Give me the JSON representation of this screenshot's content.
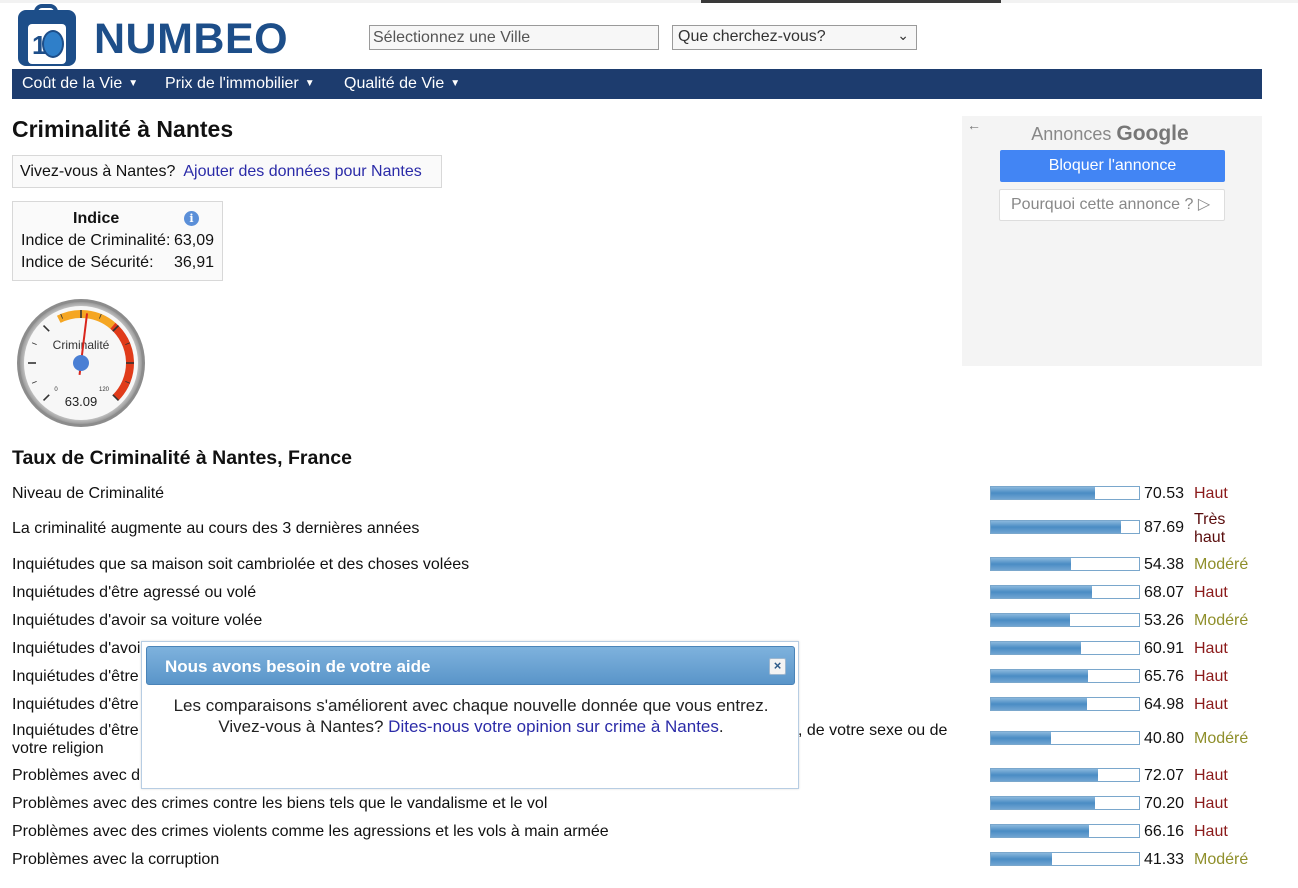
{
  "header": {
    "logo_text": "NUMBEO",
    "city_placeholder": "Sélectionnez une Ville",
    "search_select_value": "Que cherchez-vous?"
  },
  "nav": {
    "items": [
      {
        "label": "Coût de la Vie"
      },
      {
        "label": "Prix de l'immobilier"
      },
      {
        "label": "Qualité de Vie"
      }
    ]
  },
  "page": {
    "title": "Criminalité à Nantes",
    "live_question": "Vivez-vous à Nantes?",
    "live_link": "Ajouter des données pour Nantes"
  },
  "index": {
    "heading": "Indice",
    "crime_label": "Indice de Criminalité:",
    "crime_value": "63,09",
    "safety_label": "Indice de Sécurité:",
    "safety_value": "36,91"
  },
  "gauge": {
    "label": "Criminalité",
    "value": "63.09",
    "numeric_value": 63.09,
    "min_label": "0",
    "max_label": "120",
    "max": 120
  },
  "ad": {
    "back_icon": "arrow-left-icon",
    "title_prefix": "Annonces",
    "title_brand": "Google",
    "block_label": "Bloquer l'annonce",
    "why_label": "Pourquoi cette annonce ?"
  },
  "section": {
    "title": "Taux de Criminalité à Nantes, France"
  },
  "crime_rows": [
    {
      "label": "Niveau de Criminalité",
      "value": "70.53",
      "level": "Haut",
      "pct": 70.53
    },
    {
      "label": "La criminalité augmente au cours des 3 dernières années",
      "value": "87.69",
      "level": "Très haut",
      "pct": 87.69
    },
    {
      "label": "Inquiétudes que sa maison soit cambriolée et des choses volées",
      "value": "54.38",
      "level": "Modéré",
      "pct": 54.38
    },
    {
      "label": "Inquiétudes d'être agressé ou volé",
      "value": "68.07",
      "level": "Haut",
      "pct": 68.07
    },
    {
      "label": "Inquiétudes d'avoir sa voiture volée",
      "value": "53.26",
      "level": "Modéré",
      "pct": 53.26
    },
    {
      "label": "Inquiétudes d'avoi",
      "value": "60.91",
      "level": "Haut",
      "pct": 60.91
    },
    {
      "label": "Inquiétudes d'être",
      "value": "65.76",
      "level": "Haut",
      "pct": 65.76
    },
    {
      "label": "Inquiétudes d'être",
      "value": "64.98",
      "level": "Haut",
      "pct": 64.98
    },
    {
      "label": "Inquiétudes d'être",
      "label_tail": ", de votre sexe ou de",
      "label_line2": "votre religion",
      "value": "40.80",
      "level": "Modéré",
      "pct": 40.8
    },
    {
      "label": "Problèmes avec d",
      "value": "72.07",
      "level": "Haut",
      "pct": 72.07
    },
    {
      "label": "Problèmes avec des crimes contre les biens tels que le vandalisme et le vol",
      "value": "70.20",
      "level": "Haut",
      "pct": 70.2
    },
    {
      "label": "Problèmes avec des crimes violents comme les agressions et les vols à main armée",
      "value": "66.16",
      "level": "Haut",
      "pct": 66.16
    },
    {
      "label": "Problèmes avec la corruption",
      "value": "41.33",
      "level": "Modéré",
      "pct": 41.33
    }
  ],
  "level_colors": {
    "Haut": "#8b1a1a",
    "Très haut": "#5a0d0d",
    "Modéré": "#8f8f2a"
  },
  "modal": {
    "title": "Nous avons besoin de votre aide",
    "close_icon": "close-icon",
    "line1": "Les comparaisons s'améliorent avec chaque nouvelle donnée que vous entrez.",
    "question": "Vivez-vous à Nantes?",
    "link": "Dites-nous votre opinion sur crime à Nantes",
    "period": "."
  }
}
